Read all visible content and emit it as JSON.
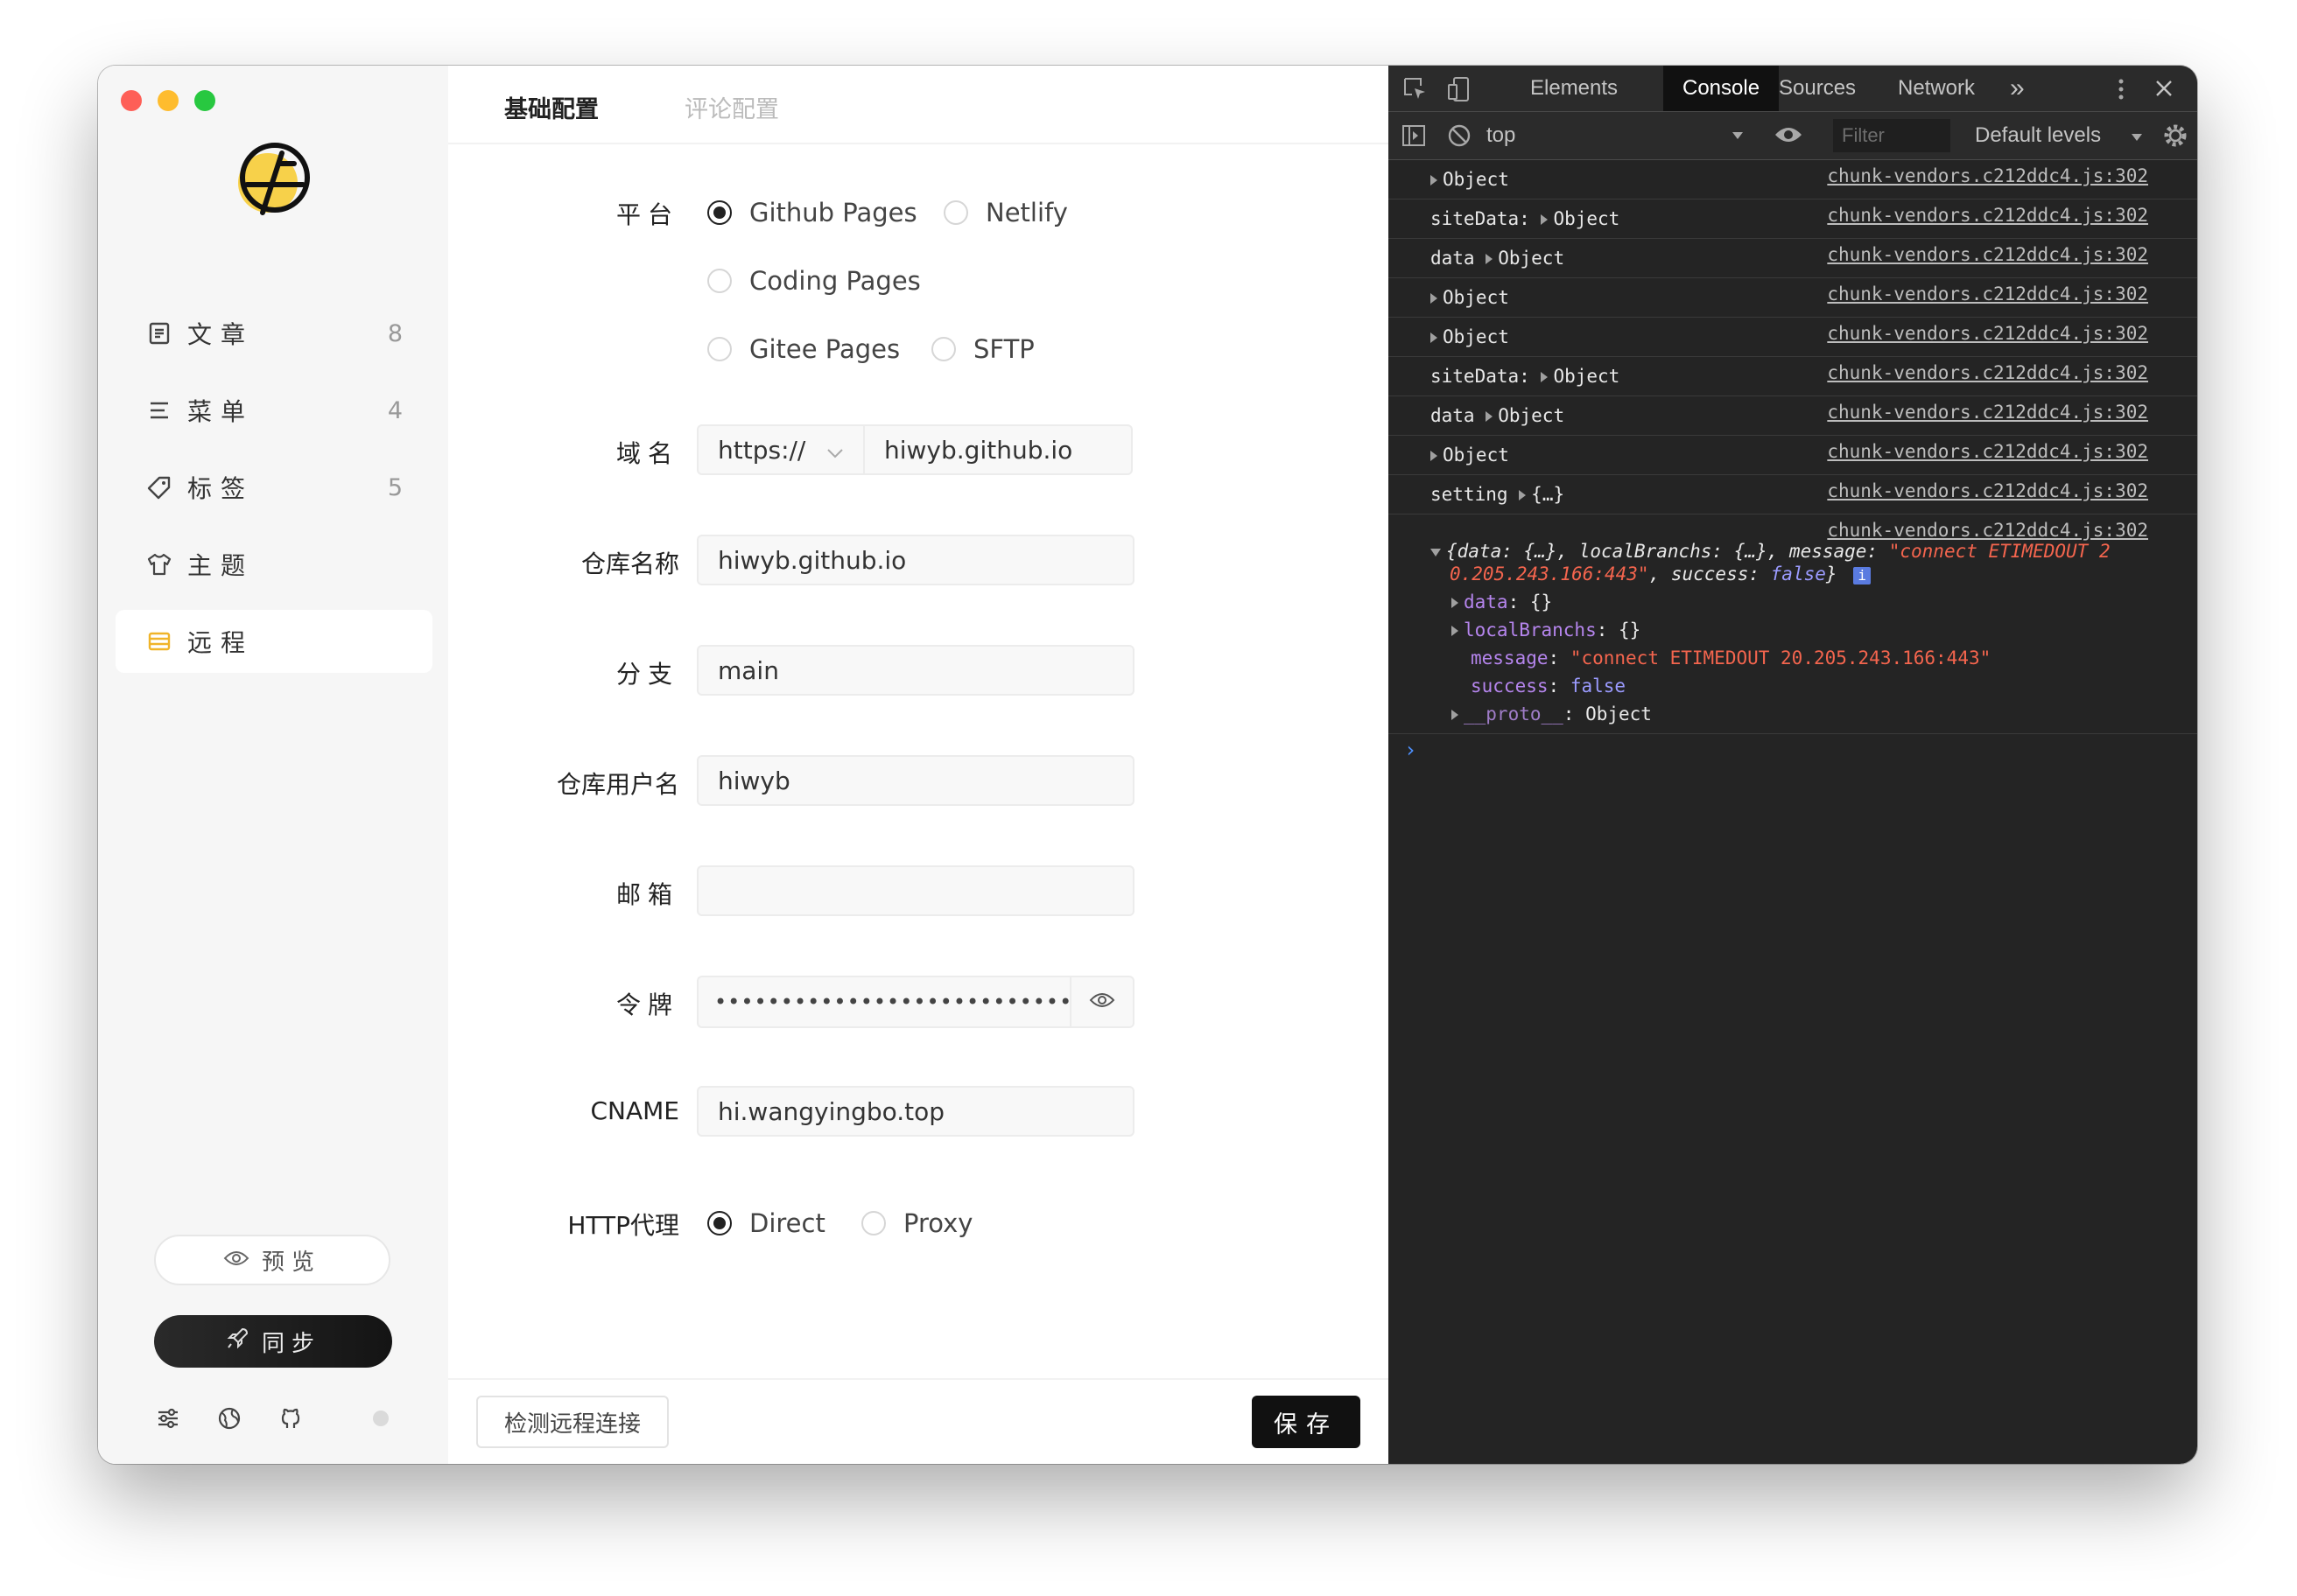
{
  "sidebar": {
    "nav": [
      {
        "label": "文章",
        "count": "8",
        "icon": "article-icon"
      },
      {
        "label": "菜单",
        "count": "4",
        "icon": "menu-icon"
      },
      {
        "label": "标签",
        "count": "5",
        "icon": "tag-icon"
      },
      {
        "label": "主题",
        "count": "",
        "icon": "shirt-icon"
      },
      {
        "label": "远程",
        "count": "",
        "icon": "remote-icon",
        "active": true
      }
    ],
    "preview_label": "预览",
    "sync_label": "同步",
    "traffic_colors": [
      "#fe5f57",
      "#febc2e",
      "#28c840"
    ],
    "accent": "#f7d14a"
  },
  "tabs": {
    "basic": "基础配置",
    "comment": "评论配置"
  },
  "form": {
    "platform": {
      "label": "平台",
      "options": [
        "Github Pages",
        "Netlify",
        "Coding Pages",
        "Gitee Pages",
        "SFTP"
      ],
      "selected": "Github Pages"
    },
    "domain": {
      "label": "域名",
      "protocol": "https://",
      "value": "hiwyb.github.io"
    },
    "repo": {
      "label": "仓库名称",
      "value": "hiwyb.github.io"
    },
    "branch": {
      "label": "分支",
      "value": "main"
    },
    "username": {
      "label": "仓库用户名",
      "value": "hiwyb"
    },
    "email": {
      "label": "邮箱",
      "value": ""
    },
    "token": {
      "label": "令牌",
      "value": "••••••••••••••••••••••••••••"
    },
    "cname": {
      "label": "CNAME",
      "value": "hi.wangyingbo.top"
    },
    "proxy": {
      "label": "HTTP代理",
      "options": [
        "Direct",
        "Proxy"
      ],
      "selected": "Direct"
    }
  },
  "footer": {
    "check_label": "检测远程连接",
    "save_label": "保存"
  },
  "devtools": {
    "tabs": [
      "Elements",
      "Console",
      "Sources",
      "Network"
    ],
    "active_tab": "Console",
    "more": "»",
    "context": "top",
    "filter_placeholder": "Filter",
    "levels": "Default levels",
    "logs": [
      {
        "prefix": "",
        "msg": "Object",
        "src": "chunk-vendors.c212ddc4.js:302"
      },
      {
        "prefix": "siteData:",
        "msg": "Object",
        "src": "chunk-vendors.c212ddc4.js:302"
      },
      {
        "prefix": "data",
        "msg": "Object",
        "src": "chunk-vendors.c212ddc4.js:302"
      },
      {
        "prefix": "",
        "msg": "Object",
        "src": "chunk-vendors.c212ddc4.js:302"
      },
      {
        "prefix": "",
        "msg": "Object",
        "src": "chunk-vendors.c212ddc4.js:302"
      },
      {
        "prefix": "siteData:",
        "msg": "Object",
        "src": "chunk-vendors.c212ddc4.js:302"
      },
      {
        "prefix": "data",
        "msg": "Object",
        "src": "chunk-vendors.c212ddc4.js:302"
      },
      {
        "prefix": "",
        "msg": "Object",
        "src": "chunk-vendors.c212ddc4.js:302"
      },
      {
        "prefix": "setting",
        "msg": "{…}",
        "src": "chunk-vendors.c212ddc4.js:302"
      }
    ],
    "expanded": {
      "src": "chunk-vendors.c212ddc4.js:302",
      "summary_a": "{data: {…}, localBranchs: {…}, message: ",
      "summary_str": "\"connect ETIMEDOUT 2",
      "summary_str2": "0.205.243.166:443\"",
      "summary_b": ", success: ",
      "summary_bool": "false",
      "summary_end": "}",
      "info_badge": "i",
      "data_key": "data",
      "data_val": "{}",
      "branch_key": "localBranchs",
      "branch_val": "{}",
      "message_key": "message",
      "message_val": "\"connect ETIMEDOUT 20.205.243.166:443\"",
      "success_key": "success",
      "success_val": "false",
      "proto_key": "__proto__",
      "proto_val": "Object"
    },
    "prompt": "›"
  }
}
